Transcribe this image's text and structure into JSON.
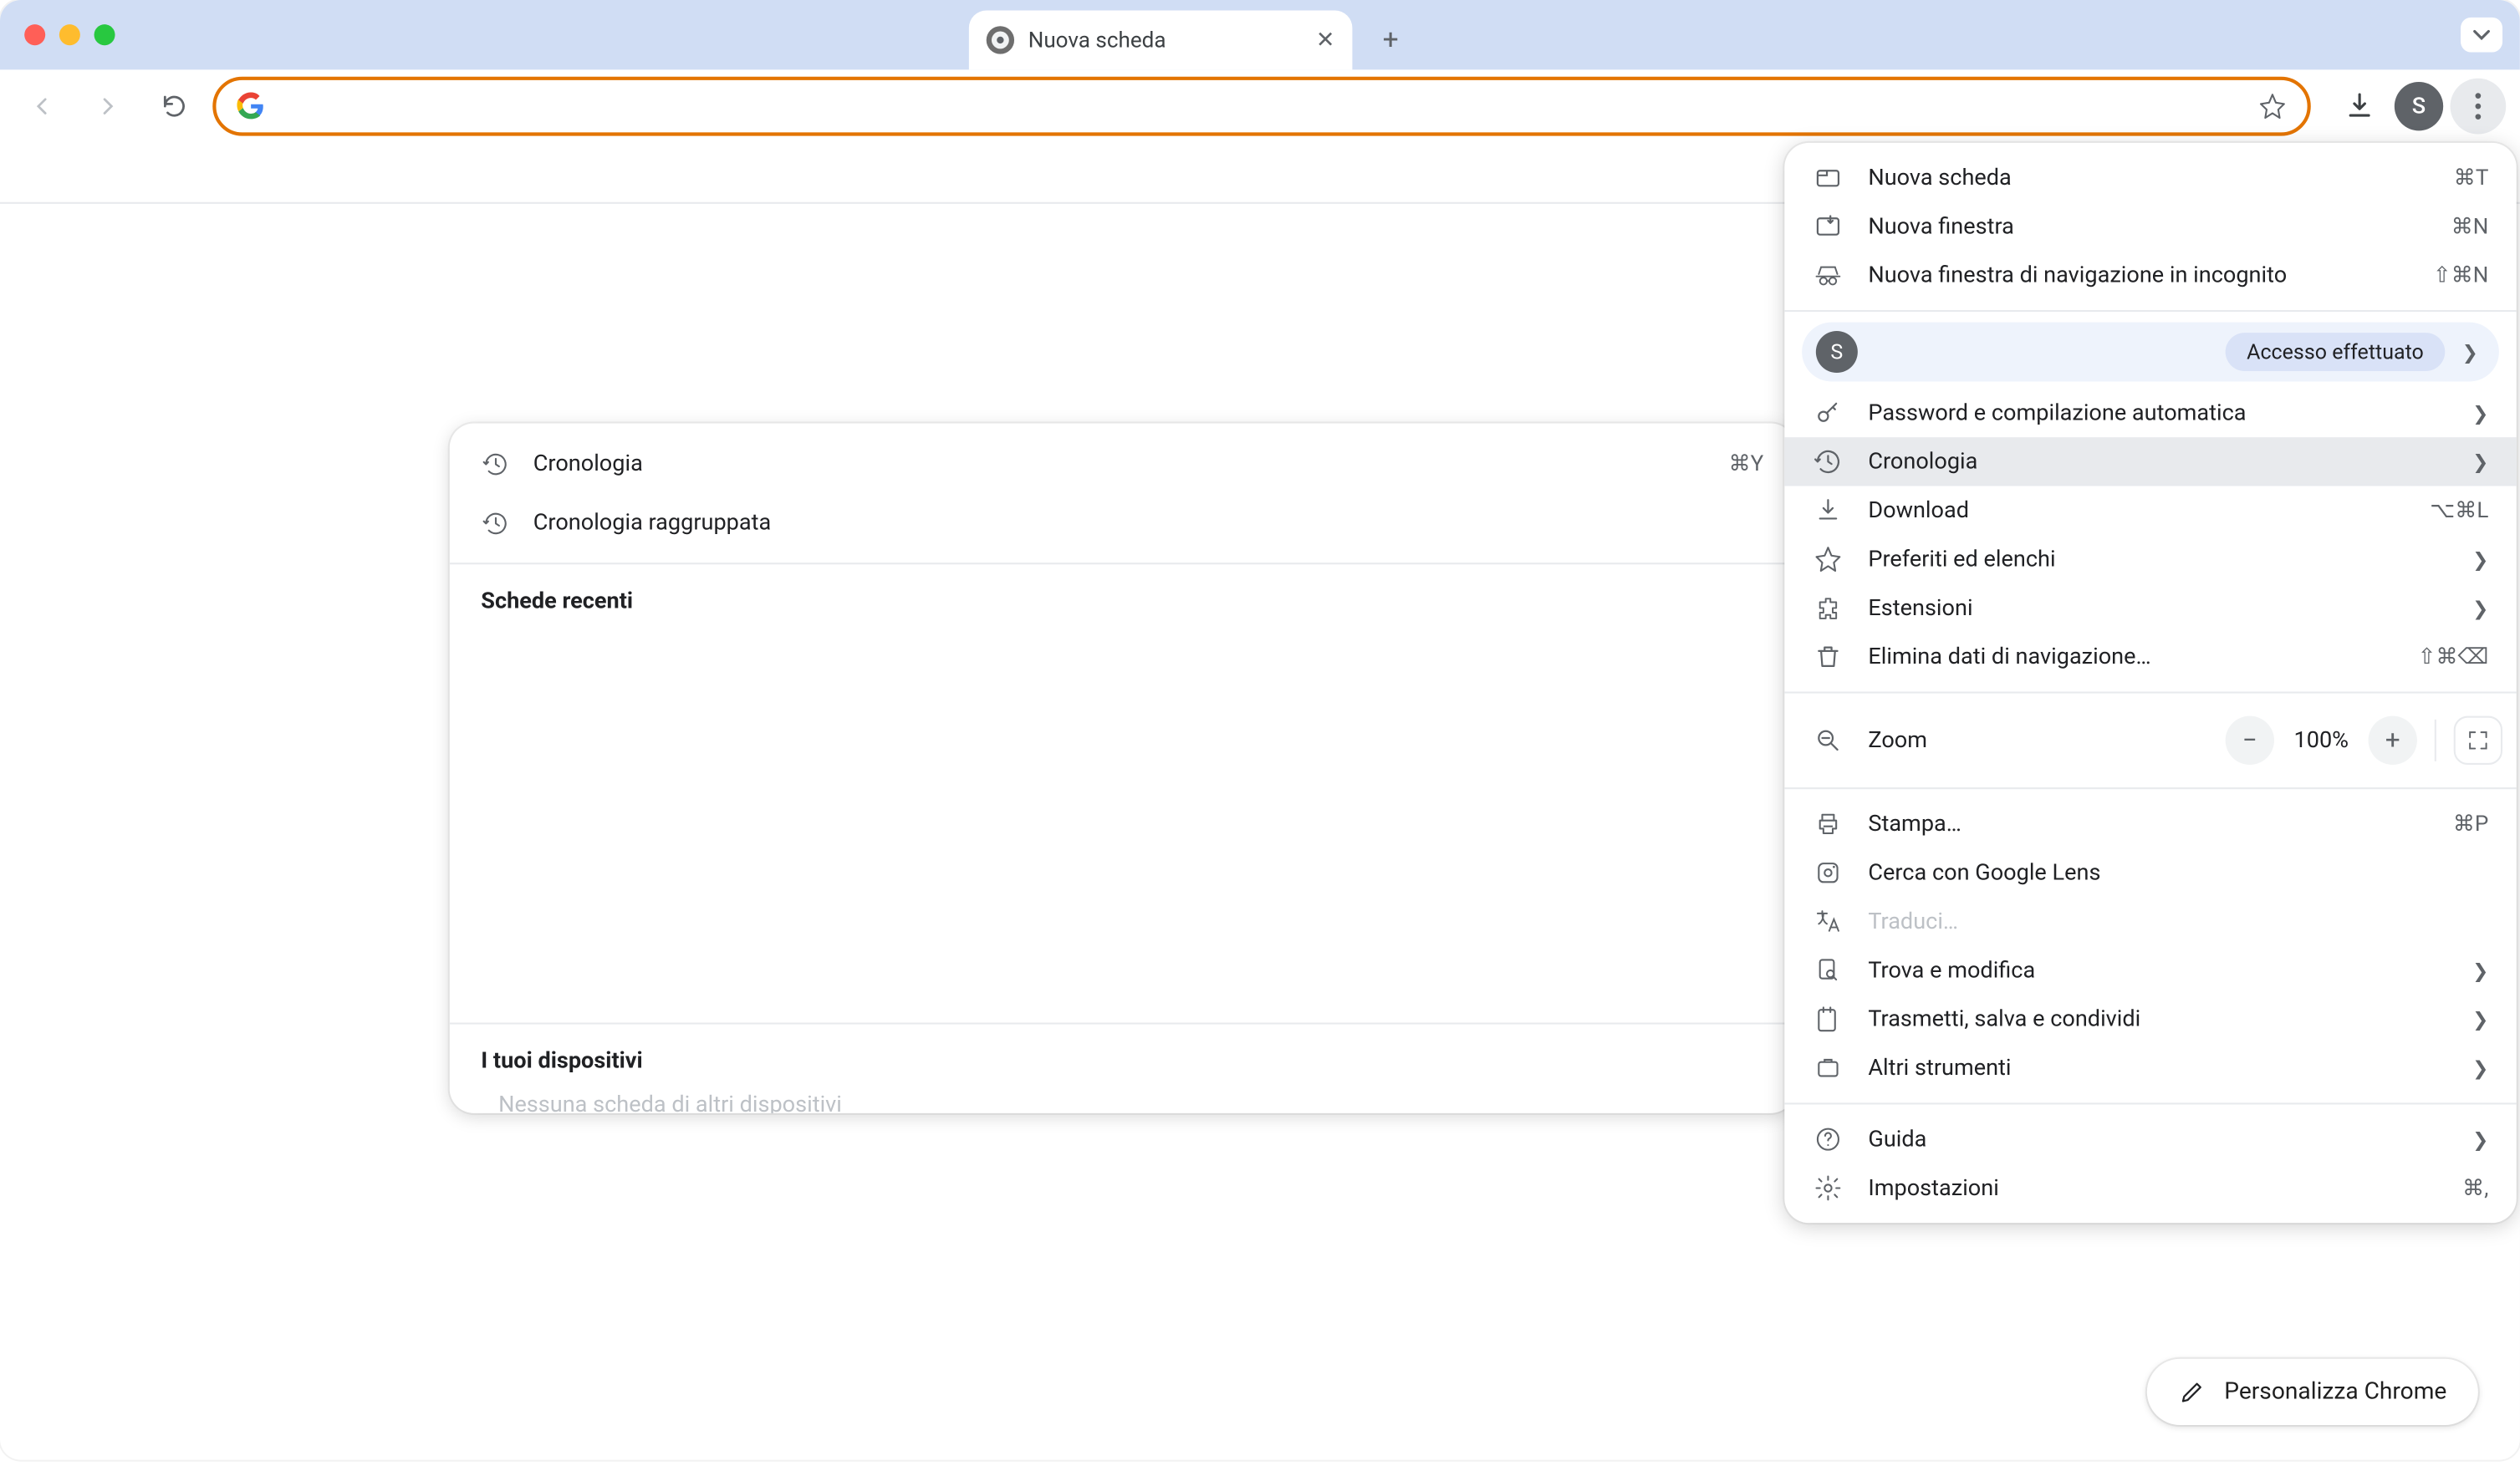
{
  "window": {
    "tab_title": "Nuova scheda",
    "profile_initial": "S"
  },
  "history_panel": {
    "items": [
      {
        "label": "Cronologia",
        "shortcut": "⌘Y"
      },
      {
        "label": "Cronologia raggruppata",
        "shortcut": ""
      }
    ],
    "recent_header": "Schede recenti",
    "devices_header": "I tuoi dispositivi",
    "devices_empty": "Nessuna scheda di altri dispositivi"
  },
  "menu": {
    "group1": [
      {
        "icon": "tab",
        "label": "Nuova scheda",
        "shortcut": "⌘T"
      },
      {
        "icon": "window",
        "label": "Nuova finestra",
        "shortcut": "⌘N"
      },
      {
        "icon": "incognito",
        "label": "Nuova finestra di navigazione in incognito",
        "shortcut": "⇧⌘N"
      }
    ],
    "profile": {
      "initial": "S",
      "badge": "Accesso effettuato"
    },
    "group2": [
      {
        "icon": "key",
        "label": "Password e compilazione automatica",
        "arrow": true
      },
      {
        "icon": "history",
        "label": "Cronologia",
        "arrow": true,
        "hover": true
      },
      {
        "icon": "download",
        "label": "Download",
        "shortcut": "⌥⌘L"
      },
      {
        "icon": "star",
        "label": "Preferiti ed elenchi",
        "arrow": true
      },
      {
        "icon": "extension",
        "label": "Estensioni",
        "arrow": true
      },
      {
        "icon": "trash",
        "label": "Elimina dati di navigazione…",
        "shortcut": "⇧⌘⌫"
      }
    ],
    "zoom": {
      "label": "Zoom",
      "value": "100%"
    },
    "group3": [
      {
        "icon": "print",
        "label": "Stampa…",
        "shortcut": "⌘P"
      },
      {
        "icon": "lens",
        "label": "Cerca con Google Lens"
      },
      {
        "icon": "translate",
        "label": "Traduci…",
        "disabled": true
      },
      {
        "icon": "find",
        "label": "Trova e modifica",
        "arrow": true
      },
      {
        "icon": "cast",
        "label": "Trasmetti, salva e condividi",
        "arrow": true
      },
      {
        "icon": "tools",
        "label": "Altri strumenti",
        "arrow": true
      }
    ],
    "group4": [
      {
        "icon": "help",
        "label": "Guida",
        "arrow": true
      },
      {
        "icon": "settings",
        "label": "Impostazioni",
        "shortcut": "⌘,"
      }
    ]
  },
  "customize": {
    "label": "Personalizza Chrome"
  }
}
